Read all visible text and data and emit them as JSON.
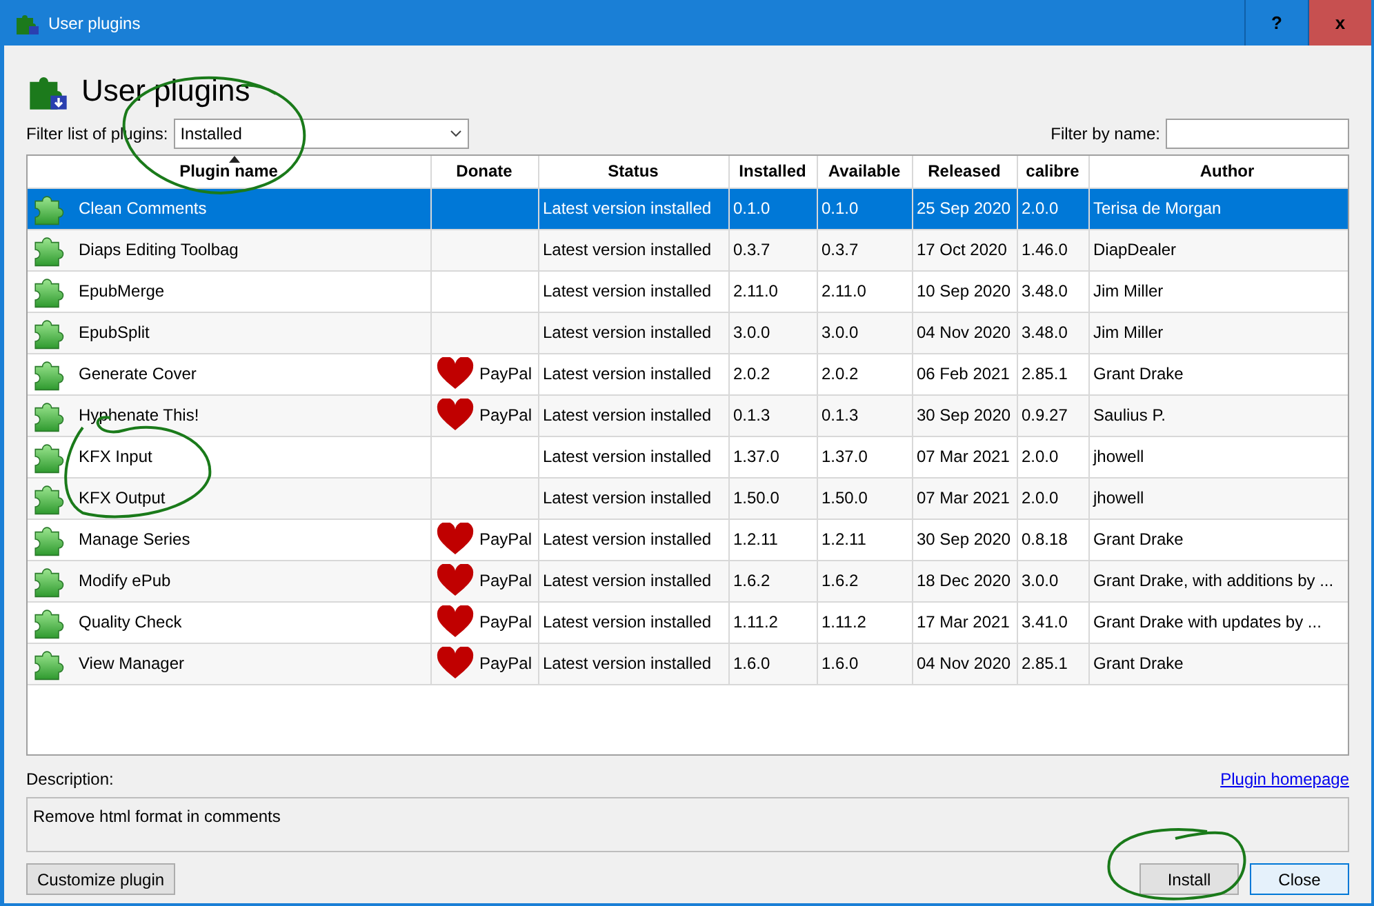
{
  "window": {
    "title": "User plugins",
    "help_button": "?",
    "close_button": "x"
  },
  "heading": "User plugins",
  "filter": {
    "label": "Filter list of plugins:",
    "value": "Installed"
  },
  "name_filter": {
    "label": "Filter by name:"
  },
  "table": {
    "columns": [
      {
        "label": "Plugin name",
        "sorted": true
      },
      {
        "label": "Donate",
        "sorted": false
      },
      {
        "label": "Status",
        "sorted": false
      },
      {
        "label": "Installed",
        "sorted": false
      },
      {
        "label": "Available",
        "sorted": false
      },
      {
        "label": "Released",
        "sorted": false
      },
      {
        "label": "calibre",
        "sorted": false
      },
      {
        "label": "Author",
        "sorted": false
      }
    ],
    "rows": [
      {
        "name": "Clean Comments",
        "donate": "",
        "status": "Latest version installed",
        "installed": "0.1.0",
        "available": "0.1.0",
        "released": "25 Sep 2020",
        "calibre": "2.0.0",
        "author": "Terisa de Morgan",
        "selected": true
      },
      {
        "name": "Diaps Editing Toolbag",
        "donate": "",
        "status": "Latest version installed",
        "installed": "0.3.7",
        "available": "0.3.7",
        "released": "17 Oct 2020",
        "calibre": "1.46.0",
        "author": "DiapDealer",
        "selected": false
      },
      {
        "name": "EpubMerge",
        "donate": "",
        "status": "Latest version installed",
        "installed": "2.11.0",
        "available": "2.11.0",
        "released": "10 Sep 2020",
        "calibre": "3.48.0",
        "author": "Jim Miller",
        "selected": false
      },
      {
        "name": "EpubSplit",
        "donate": "",
        "status": "Latest version installed",
        "installed": "3.0.0",
        "available": "3.0.0",
        "released": "04 Nov 2020",
        "calibre": "3.48.0",
        "author": "Jim Miller",
        "selected": false
      },
      {
        "name": "Generate Cover",
        "donate": "PayPal",
        "status": "Latest version installed",
        "installed": "2.0.2",
        "available": "2.0.2",
        "released": "06 Feb 2021",
        "calibre": "2.85.1",
        "author": "Grant Drake",
        "selected": false
      },
      {
        "name": "Hyphenate This!",
        "donate": "PayPal",
        "status": "Latest version installed",
        "installed": "0.1.3",
        "available": "0.1.3",
        "released": "30 Sep 2020",
        "calibre": "0.9.27",
        "author": "Saulius P.",
        "selected": false
      },
      {
        "name": "KFX Input",
        "donate": "",
        "status": "Latest version installed",
        "installed": "1.37.0",
        "available": "1.37.0",
        "released": "07 Mar 2021",
        "calibre": "2.0.0",
        "author": "jhowell",
        "selected": false
      },
      {
        "name": "KFX Output",
        "donate": "",
        "status": "Latest version installed",
        "installed": "1.50.0",
        "available": "1.50.0",
        "released": "07 Mar 2021",
        "calibre": "2.0.0",
        "author": "jhowell",
        "selected": false
      },
      {
        "name": "Manage Series",
        "donate": "PayPal",
        "status": "Latest version installed",
        "installed": "1.2.11",
        "available": "1.2.11",
        "released": "30 Sep 2020",
        "calibre": "0.8.18",
        "author": "Grant Drake",
        "selected": false
      },
      {
        "name": "Modify ePub",
        "donate": "PayPal",
        "status": "Latest version installed",
        "installed": "1.6.2",
        "available": "1.6.2",
        "released": "18 Dec 2020",
        "calibre": "3.0.0",
        "author": "Grant Drake, with additions by ...",
        "selected": false
      },
      {
        "name": "Quality Check",
        "donate": "PayPal",
        "status": "Latest version installed",
        "installed": "1.11.2",
        "available": "1.11.2",
        "released": "17 Mar 2021",
        "calibre": "3.41.0",
        "author": "Grant Drake with updates by ...",
        "selected": false
      },
      {
        "name": "View Manager",
        "donate": "PayPal",
        "status": "Latest version installed",
        "installed": "1.6.0",
        "available": "1.6.0",
        "released": "04 Nov 2020",
        "calibre": "2.85.1",
        "author": "Grant Drake",
        "selected": false
      }
    ]
  },
  "description": {
    "label": "Description:",
    "homepage_link": "Plugin homepage",
    "text": "Remove html format in comments"
  },
  "buttons": {
    "customize": "Customize plugin",
    "install": "Install",
    "close": "Close"
  }
}
